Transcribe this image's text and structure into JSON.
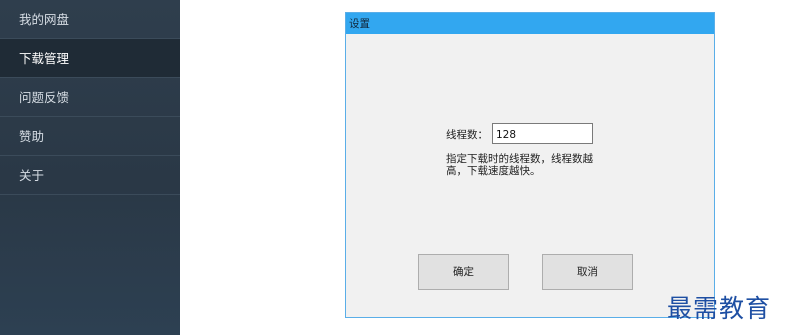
{
  "sidebar": {
    "items": [
      {
        "label": "我的网盘",
        "active": false
      },
      {
        "label": "下载管理",
        "active": true
      },
      {
        "label": "问题反馈",
        "active": false
      },
      {
        "label": "赞助",
        "active": false
      },
      {
        "label": "关于",
        "active": false
      }
    ]
  },
  "dialog": {
    "title": "设置",
    "thread_label": "线程数：",
    "thread_value": "128",
    "hint": "指定下载时的线程数，线程数越高，下载速度越快。",
    "ok_label": "确定",
    "cancel_label": "取消"
  },
  "watermark": "最需教育",
  "colors": {
    "sidebar_bg": "#2f3e4d",
    "sidebar_active": "#1f2b36",
    "titlebar": "#32a7f0",
    "watermark": "#1e4fa3"
  }
}
